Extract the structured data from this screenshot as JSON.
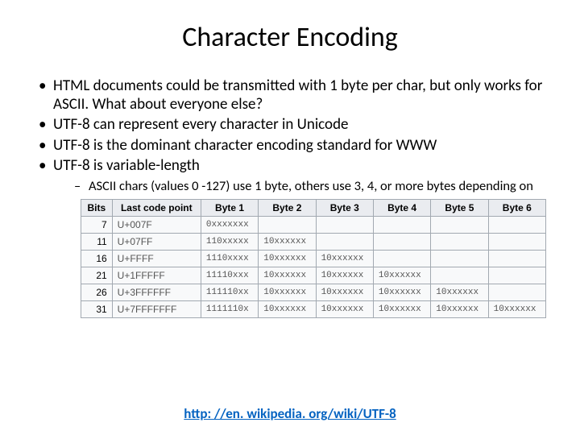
{
  "title": "Character Encoding",
  "bullets": [
    "HTML documents could be transmitted with 1 byte per char, but only works for ASCII. What about everyone else?",
    "UTF-8 can represent every character in Unicode",
    "UTF-8 is the dominant character encoding standard for WWW",
    "UTF-8 is variable-length"
  ],
  "sub_bullet": "ASCII chars (values 0 -127) use 1 byte, others use 3, 4, or more bytes depending on",
  "table": {
    "headers": [
      "Bits",
      "Last code point",
      "Byte 1",
      "Byte 2",
      "Byte 3",
      "Byte 4",
      "Byte 5",
      "Byte 6"
    ],
    "rows": [
      {
        "bits": "7",
        "cp": "U+007F",
        "b": [
          "0xxxxxxx",
          "",
          "",
          "",
          "",
          ""
        ]
      },
      {
        "bits": "11",
        "cp": "U+07FF",
        "b": [
          "110xxxxx",
          "10xxxxxx",
          "",
          "",
          "",
          ""
        ]
      },
      {
        "bits": "16",
        "cp": "U+FFFF",
        "b": [
          "1110xxxx",
          "10xxxxxx",
          "10xxxxxx",
          "",
          "",
          ""
        ]
      },
      {
        "bits": "21",
        "cp": "U+1FFFFF",
        "b": [
          "11110xxx",
          "10xxxxxx",
          "10xxxxxx",
          "10xxxxxx",
          "",
          ""
        ]
      },
      {
        "bits": "26",
        "cp": "U+3FFFFFF",
        "b": [
          "111110xx",
          "10xxxxxx",
          "10xxxxxx",
          "10xxxxxx",
          "10xxxxxx",
          ""
        ]
      },
      {
        "bits": "31",
        "cp": "U+7FFFFFFF",
        "b": [
          "1111110x",
          "10xxxxxx",
          "10xxxxxx",
          "10xxxxxx",
          "10xxxxxx",
          "10xxxxxx"
        ]
      }
    ]
  },
  "source_label": "http: //en. wikipedia. org/wiki/UTF-8",
  "source_href": "http://en.wikipedia.org/wiki/UTF-8"
}
